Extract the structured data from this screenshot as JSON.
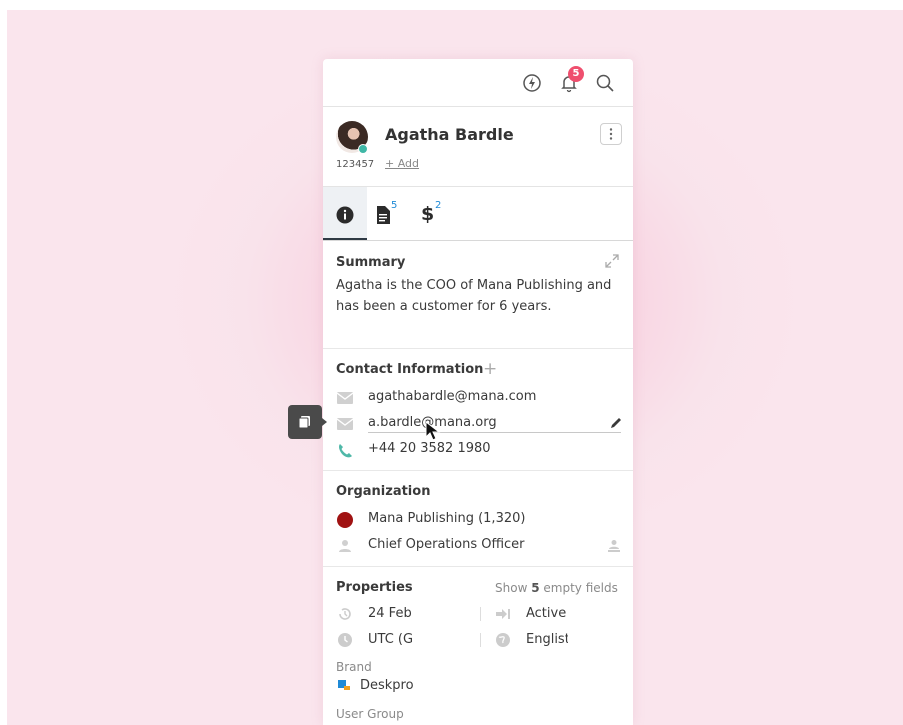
{
  "topbar": {
    "notification_count": "5"
  },
  "person": {
    "name": "Agatha Bardle",
    "id": "123457",
    "add_label": "+ Add"
  },
  "tabs": [
    {
      "icon": "info-icon",
      "count": ""
    },
    {
      "icon": "document-icon",
      "count": "5"
    },
    {
      "icon": "dollar-icon",
      "count": "2"
    }
  ],
  "summary": {
    "title": "Summary",
    "line1": "Agatha is the COO of Mana Publishing and",
    "line2": "has been a customer for 6 years."
  },
  "contact": {
    "title": "Contact Information",
    "add": "+",
    "email1": "agathabardle@mana.com",
    "email2": "a.bardle@mana.org",
    "phone": "+44 20 3582 1980"
  },
  "organization": {
    "title": "Organization",
    "company": "Mana Publishing (1,320)",
    "role": "Chief Operations Officer"
  },
  "properties": {
    "title": "Properties",
    "show_prefix": "Show ",
    "show_count": "5",
    "show_suffix": " empty fields",
    "date": "24 Feb",
    "status": "Active",
    "timezone": "UTC (G",
    "language": "Englist",
    "brand_label": "Brand",
    "brand_value": "Deskpro",
    "user_group_label": "User Group"
  },
  "colors": {
    "accent": "#1f8ad6",
    "badge": "#ef4f6e",
    "org_dot": "#a01212",
    "online": "#3fb7a6",
    "phone": "#4fb8a8"
  }
}
